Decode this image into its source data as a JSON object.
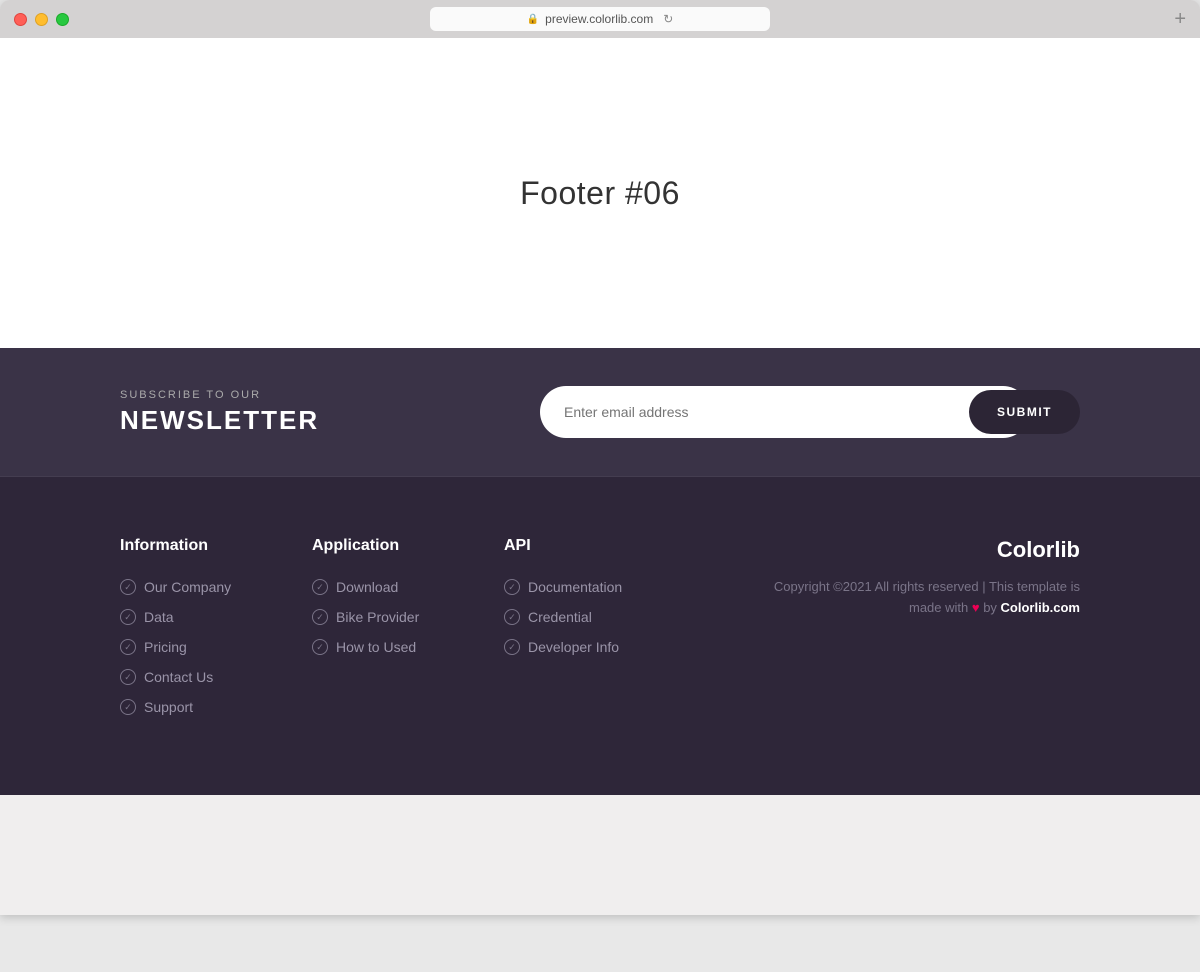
{
  "browser": {
    "url": "preview.colorlib.com",
    "new_tab_label": "+"
  },
  "hero": {
    "title": "Footer #06"
  },
  "newsletter": {
    "subscribe_label": "SUBSCRIBE TO OUR",
    "title": "NEWSLETTER",
    "input_placeholder": "Enter email address",
    "submit_label": "SUBMIT"
  },
  "footer": {
    "columns": [
      {
        "id": "information",
        "title": "Information",
        "links": [
          "Our Company",
          "Data",
          "Pricing",
          "Contact Us",
          "Support"
        ]
      },
      {
        "id": "application",
        "title": "Application",
        "links": [
          "Download",
          "Bike Provider",
          "How to Used"
        ]
      },
      {
        "id": "api",
        "title": "API",
        "links": [
          "Documentation",
          "Credential",
          "Developer Info"
        ]
      }
    ],
    "brand": "Colorlib",
    "copyright_text": "Copyright ©2021 All rights reserved | This template is made with",
    "copyright_link_text": "Colorlib.com",
    "heart_symbol": "♥"
  }
}
